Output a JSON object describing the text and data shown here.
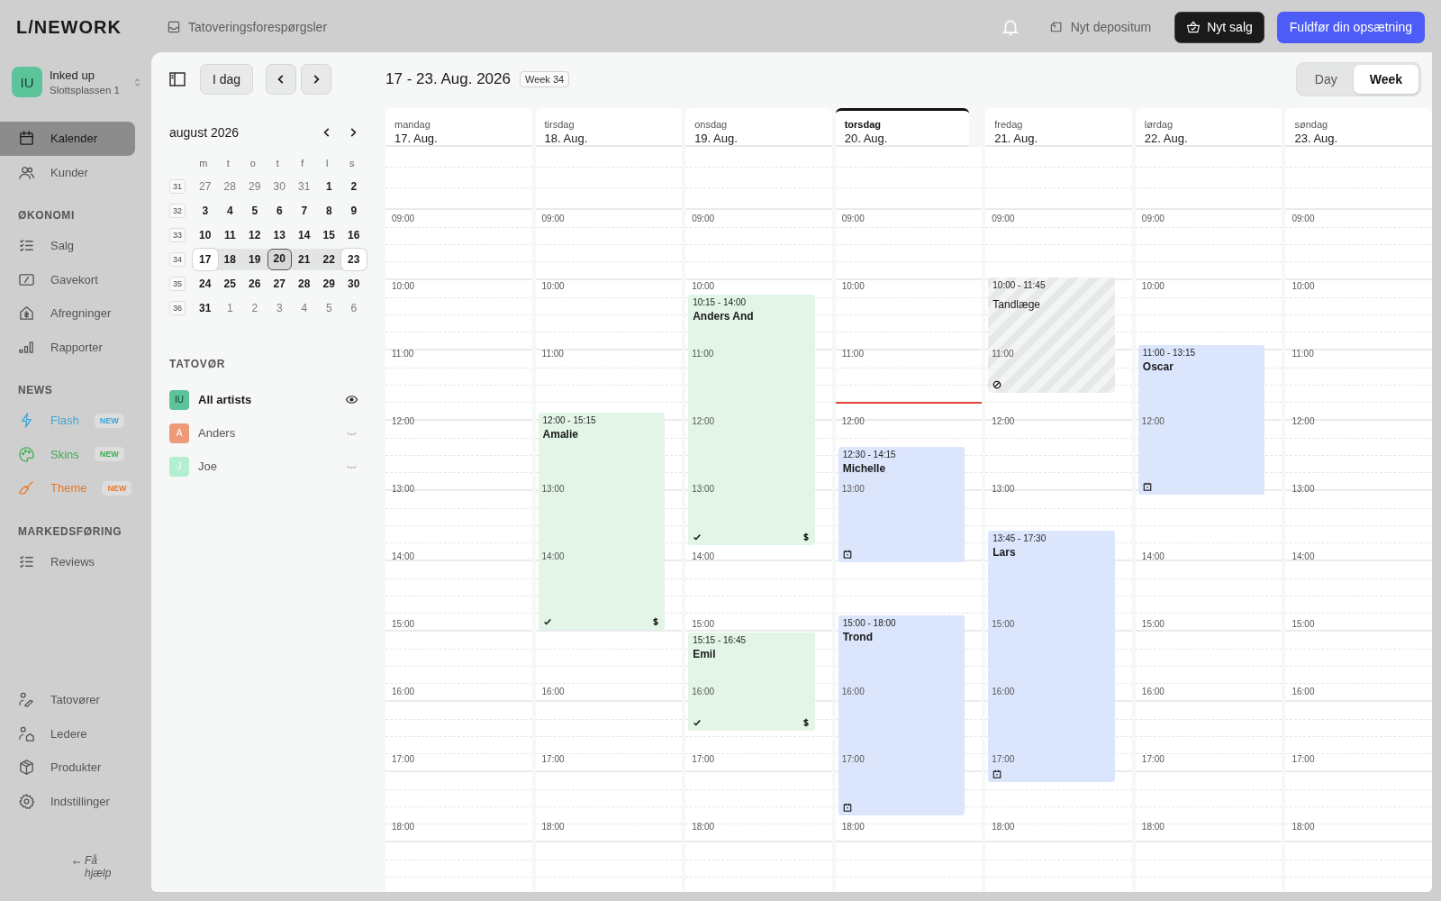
{
  "topbar": {
    "logo": "L/NEWORK",
    "inbox": "Tatoveringsforespørgsler",
    "deposit": "Nyt depositum",
    "sale_button": "Nyt salg",
    "setup_button": "Fuldfør din opsætning"
  },
  "sidebar": {
    "account": {
      "initials": "IU",
      "name": "Inked up",
      "location": "Slottsplassen 1"
    },
    "sections": [
      {
        "items": [
          {
            "label": "Kalender",
            "selected": true
          },
          {
            "label": "Kunder",
            "selected": false
          }
        ]
      },
      {
        "title": "ØKONOMI",
        "items": [
          {
            "label": "Salg",
            "selected": false
          },
          {
            "label": "Gavekort",
            "selected": false
          },
          {
            "label": "Afregninger",
            "selected": false
          },
          {
            "label": "Rapporter",
            "selected": false
          }
        ]
      },
      {
        "title": "NEWS",
        "items": [
          {
            "label": "Flash",
            "selected": false,
            "badge": "NEW",
            "color": "#3aa6d6"
          },
          {
            "label": "Skins",
            "selected": false,
            "badge": "NEW",
            "color": "#3fae52"
          },
          {
            "label": "Theme",
            "selected": false,
            "badge": "NEW",
            "color": "#e5792b"
          }
        ]
      },
      {
        "title": "MARKEDSFØRING",
        "items": [
          {
            "label": "Reviews",
            "selected": false
          }
        ]
      },
      {
        "items": [
          {
            "label": "Tatovører",
            "selected": false
          },
          {
            "label": "Ledere",
            "selected": false
          },
          {
            "label": "Produkter",
            "selected": false
          },
          {
            "label": "Indstillinger",
            "selected": false
          }
        ]
      }
    ],
    "help": "Få hjælp"
  },
  "toolbar": {
    "today_button": "I dag"
  },
  "mini_calendar": {
    "title": "august 2026",
    "weekdays": [
      "m",
      "t",
      "o",
      "t",
      "f",
      "l",
      "s"
    ],
    "weeks": [
      {
        "number": "31",
        "selected": false,
        "days": [
          {
            "label": "27",
            "muted": true,
            "today": false
          },
          {
            "label": "28",
            "muted": true,
            "today": false
          },
          {
            "label": "29",
            "muted": true,
            "today": false
          },
          {
            "label": "30",
            "muted": true,
            "today": false
          },
          {
            "label": "31",
            "muted": true,
            "today": false
          },
          {
            "label": "1",
            "muted": false,
            "today": false
          },
          {
            "label": "2",
            "muted": false,
            "today": false
          }
        ]
      },
      {
        "number": "32",
        "selected": false,
        "days": [
          {
            "label": "3",
            "muted": false,
            "today": false
          },
          {
            "label": "4",
            "muted": false,
            "today": false
          },
          {
            "label": "5",
            "muted": false,
            "today": false
          },
          {
            "label": "6",
            "muted": false,
            "today": false
          },
          {
            "label": "7",
            "muted": false,
            "today": false
          },
          {
            "label": "8",
            "muted": false,
            "today": false
          },
          {
            "label": "9",
            "muted": false,
            "today": false
          }
        ]
      },
      {
        "number": "33",
        "selected": false,
        "days": [
          {
            "label": "10",
            "muted": false,
            "today": false
          },
          {
            "label": "11",
            "muted": false,
            "today": false
          },
          {
            "label": "12",
            "muted": false,
            "today": false
          },
          {
            "label": "13",
            "muted": false,
            "today": false
          },
          {
            "label": "14",
            "muted": false,
            "today": false
          },
          {
            "label": "15",
            "muted": false,
            "today": false
          },
          {
            "label": "16",
            "muted": false,
            "today": false
          }
        ]
      },
      {
        "number": "34",
        "selected": true,
        "days": [
          {
            "label": "17",
            "muted": false,
            "today": false
          },
          {
            "label": "18",
            "muted": false,
            "today": false
          },
          {
            "label": "19",
            "muted": false,
            "today": false
          },
          {
            "label": "20",
            "muted": false,
            "today": true
          },
          {
            "label": "21",
            "muted": false,
            "today": false
          },
          {
            "label": "22",
            "muted": false,
            "today": false
          },
          {
            "label": "23",
            "muted": false,
            "today": false
          }
        ]
      },
      {
        "number": "35",
        "selected": false,
        "days": [
          {
            "label": "24",
            "muted": false,
            "today": false
          },
          {
            "label": "25",
            "muted": false,
            "today": false
          },
          {
            "label": "26",
            "muted": false,
            "today": false
          },
          {
            "label": "27",
            "muted": false,
            "today": false
          },
          {
            "label": "28",
            "muted": false,
            "today": false
          },
          {
            "label": "29",
            "muted": false,
            "today": false
          },
          {
            "label": "30",
            "muted": false,
            "today": false
          }
        ]
      },
      {
        "number": "36",
        "selected": false,
        "days": [
          {
            "label": "31",
            "muted": false,
            "today": false
          },
          {
            "label": "1",
            "muted": true,
            "today": false
          },
          {
            "label": "2",
            "muted": true,
            "today": false
          },
          {
            "label": "3",
            "muted": true,
            "today": false
          },
          {
            "label": "4",
            "muted": true,
            "today": false
          },
          {
            "label": "5",
            "muted": true,
            "today": false
          },
          {
            "label": "6",
            "muted": true,
            "today": false
          }
        ]
      }
    ]
  },
  "artists": {
    "title": "TATOVØR",
    "items": [
      {
        "initials": "IU",
        "name": "All artists",
        "color": "#5cc49a",
        "visible": true
      },
      {
        "initials": "A",
        "name": "Anders",
        "color": "#ec9a78",
        "visible": false
      },
      {
        "initials": "J",
        "name": "Joe",
        "color": "#b2f0cf",
        "visible": false
      }
    ]
  },
  "calendar": {
    "title": "17 - 23. Aug. 2026",
    "week_badge": "Week 34",
    "views": [
      {
        "label": "Day",
        "selected": false
      },
      {
        "label": "Week",
        "selected": true
      }
    ],
    "days": [
      {
        "weekday": "mandag",
        "date": "17. Aug.",
        "today": false,
        "hours": [
          "09:00",
          "10:00",
          "11:00",
          "12:00",
          "13:00",
          "14:00",
          "15:00",
          "16:00",
          "17:00",
          "18:00"
        ]
      },
      {
        "weekday": "tirsdag",
        "date": "18. Aug.",
        "today": false,
        "hours": [
          "09:00",
          "10:00",
          "11:00",
          "13:00",
          "14:00",
          "16:00",
          "17:00",
          "18:00"
        ],
        "events": [
          {
            "time": "12:00 - 15:15",
            "title": "Amalie",
            "kind": "paid"
          }
        ]
      },
      {
        "weekday": "onsdag",
        "date": "19. Aug.",
        "today": false,
        "hours": [
          "09:00",
          "10:00",
          "11:00",
          "12:00",
          "13:00",
          "14:00",
          "15:00",
          "16:00",
          "17:00",
          "18:00"
        ],
        "events": [
          {
            "time": "10:15 - 14:00",
            "title": "Anders And",
            "kind": "paid"
          },
          {
            "time": "15:15 - 16:45",
            "title": "Emil",
            "kind": "paid"
          }
        ]
      },
      {
        "weekday": "torsdag",
        "date": "20. Aug.",
        "today": true,
        "hours": [
          "09:00",
          "10:00",
          "11:00",
          "12:00",
          "13:00",
          "16:00",
          "17:00",
          "18:00"
        ],
        "events": [
          {
            "time": "12:30 - 14:15",
            "title": "Michelle",
            "kind": "booked"
          },
          {
            "time": "15:00 - 18:00",
            "title": "Trond",
            "kind": "booked"
          }
        ]
      },
      {
        "weekday": "fredag",
        "date": "21. Aug.",
        "today": false,
        "hours": [
          "09:00",
          "11:00",
          "12:00",
          "13:00",
          "15:00",
          "16:00",
          "17:00",
          "18:00"
        ],
        "events": [
          {
            "time": "10:00 - 11:45",
            "title": "Tandlæge",
            "kind": "blocked"
          },
          {
            "time": "13:45 - 17:30",
            "title": "Lars",
            "kind": "booked"
          }
        ]
      },
      {
        "weekday": "lørdag",
        "date": "22. Aug.",
        "today": false,
        "hours": [
          "09:00",
          "10:00",
          "12:00",
          "14:00",
          "15:00",
          "16:00",
          "17:00",
          "18:00"
        ],
        "events": [
          {
            "time": "11:00 - 13:15",
            "title": "Oscar",
            "kind": "booked"
          }
        ]
      },
      {
        "weekday": "søndag",
        "date": "23. Aug.",
        "today": false,
        "hours": [
          "09:00",
          "10:00",
          "11:00",
          "12:00",
          "13:00",
          "14:00",
          "15:00",
          "16:00",
          "17:00",
          "18:00"
        ]
      }
    ]
  }
}
